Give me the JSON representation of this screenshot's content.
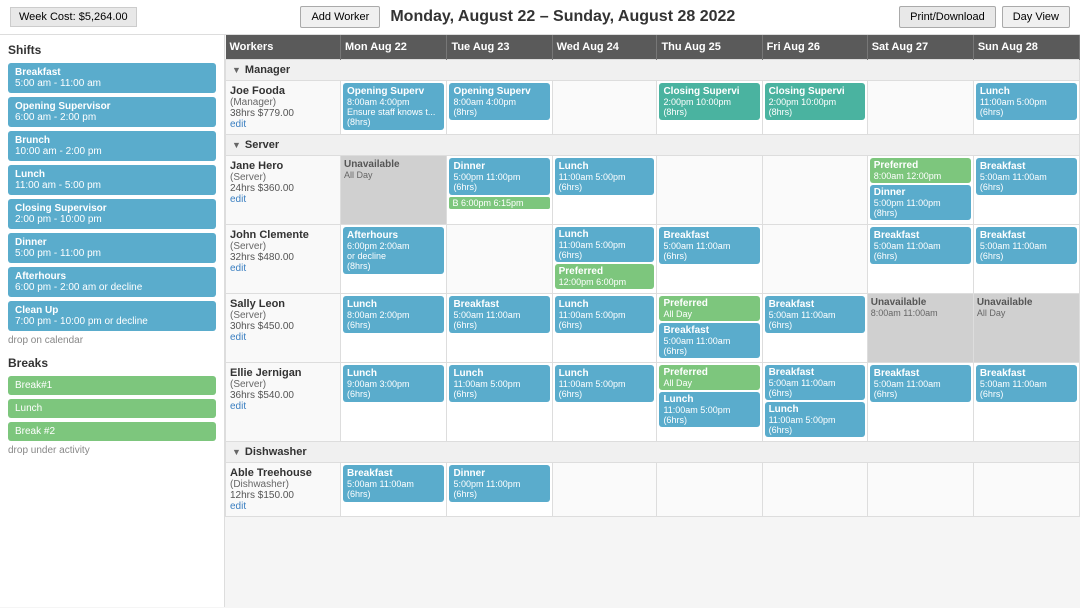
{
  "topBar": {
    "weekCost": "Week Cost: $5,264.00",
    "title": "Monday, August 22 – Sunday, August 28 2022",
    "printDownload": "Print/Download",
    "dayView": "Day View",
    "addWorker": "Add Worker"
  },
  "sidebar": {
    "shiftsTitle": "Shifts",
    "shifts": [
      {
        "name": "Breakfast",
        "time": "5:00 am - 11:00 am"
      },
      {
        "name": "Opening Supervisor",
        "time": "6:00 am - 2:00 pm"
      },
      {
        "name": "Brunch",
        "time": "10:00 am - 2:00 pm"
      },
      {
        "name": "Lunch",
        "time": "11:00 am - 5:00 pm"
      },
      {
        "name": "Closing Supervisor",
        "time": "2:00 pm - 10:00 pm"
      },
      {
        "name": "Dinner",
        "time": "5:00 pm - 11:00 pm"
      },
      {
        "name": "Afterhours",
        "time": "6:00 pm - 2:00 am or decline"
      },
      {
        "name": "Clean Up",
        "time": "7:00 pm - 10:00 pm or decline"
      }
    ],
    "dropOnCalendar": "drop on calendar",
    "breaksTitle": "Breaks",
    "breaks": [
      {
        "name": "Break#1"
      },
      {
        "name": "Lunch"
      },
      {
        "name": "Break #2"
      }
    ],
    "dropUnderActivity": "drop under activity"
  },
  "columns": {
    "workers": "Workers",
    "days": [
      "Mon Aug 22",
      "Tue Aug 23",
      "Wed Aug 24",
      "Thu Aug 25",
      "Fri Aug 26",
      "Sat Aug 27",
      "Sun Aug 28"
    ]
  },
  "sections": [
    {
      "name": "Manager",
      "workers": [
        {
          "name": "Joe Fooda",
          "role": "Manager",
          "hours": "38hrs $779.00",
          "days": [
            {
              "type": "shift",
              "class": "blue",
              "title": "Opening Superv",
              "time": "8:00am 4:00pm",
              "extra": "Ensure staff knows t...",
              "duration": "(8hrs)"
            },
            {
              "type": "shift",
              "class": "blue",
              "title": "Opening Superv",
              "time": "8:00am 4:00pm",
              "duration": "(8hrs)"
            },
            {
              "type": "empty"
            },
            {
              "type": "shift",
              "class": "teal",
              "title": "Closing Supervi",
              "time": "2:00pm 10:00pm",
              "duration": "(8hrs)"
            },
            {
              "type": "shift",
              "class": "teal",
              "title": "Closing Supervi",
              "time": "2:00pm 10:00pm",
              "duration": "(8hrs)"
            },
            {
              "type": "empty"
            },
            {
              "type": "shift",
              "class": "blue",
              "title": "Lunch",
              "time": "11:00am 5:00pm",
              "duration": "(6hrs)"
            }
          ]
        }
      ]
    },
    {
      "name": "Server",
      "workers": [
        {
          "name": "Jane Hero",
          "role": "Server",
          "hours": "24hrs $360.00",
          "days": [
            {
              "type": "unavail",
              "label": "Unavailable",
              "sub": "All Day"
            },
            {
              "type": "shift",
              "class": "blue",
              "title": "Dinner",
              "time": "5:00pm 11:00pm",
              "duration": "(6hrs)",
              "note": "B 6:00pm 6:15pm"
            },
            {
              "type": "shift",
              "class": "blue",
              "title": "Lunch",
              "time": "11:00am 5:00pm",
              "duration": "(6hrs)"
            },
            {
              "type": "empty"
            },
            {
              "type": "empty"
            },
            {
              "type": "multi",
              "shifts": [
                {
                  "class": "pref",
                  "title": "Preferred",
                  "time": "8:00am 12:00pm"
                },
                {
                  "class": "blue",
                  "title": "Dinner",
                  "time": "5:00pm 11:00pm",
                  "duration": "(8hrs)"
                }
              ]
            },
            {
              "type": "shift",
              "class": "blue",
              "title": "Breakfast",
              "time": "5:00am 11:00am",
              "duration": "(6hrs)"
            }
          ]
        },
        {
          "name": "John Clemente",
          "role": "Server",
          "hours": "32hrs $480.00",
          "days": [
            {
              "type": "shift",
              "class": "blue",
              "title": "Afterhours",
              "time": "6:00pm 2:00am",
              "extra": "or decline",
              "duration": "(8hrs)"
            },
            {
              "type": "empty"
            },
            {
              "type": "multi2",
              "shifts": [
                {
                  "class": "blue",
                  "title": "Lunch",
                  "time": "11:00am 5:00pm",
                  "duration": "(6hrs)"
                },
                {
                  "class": "pref",
                  "title": "Preferred",
                  "time": "12:00pm 6:00pm"
                }
              ]
            },
            {
              "type": "shift",
              "class": "blue",
              "title": "Breakfast",
              "time": "5:00am 11:00am",
              "duration": "(6hrs)"
            },
            {
              "type": "empty"
            },
            {
              "type": "shift",
              "class": "blue",
              "title": "Breakfast",
              "time": "5:00am 11:00am",
              "duration": "(6hrs)"
            },
            {
              "type": "shift",
              "class": "blue",
              "title": "Breakfast",
              "time": "5:00am 11:00am",
              "duration": "(6hrs)"
            }
          ]
        },
        {
          "name": "Sally Leon",
          "role": "Server",
          "hours": "30hrs $450.00",
          "days": [
            {
              "type": "shift",
              "class": "blue",
              "title": "Lunch",
              "time": "8:00am 2:00pm",
              "duration": "(6hrs)"
            },
            {
              "type": "shift",
              "class": "blue",
              "title": "Breakfast",
              "time": "5:00am 11:00am",
              "duration": "(6hrs)"
            },
            {
              "type": "shift",
              "class": "blue",
              "title": "Lunch",
              "time": "11:00am 5:00pm",
              "duration": "(6hrs)"
            },
            {
              "type": "multi2",
              "shifts": [
                {
                  "class": "pref",
                  "title": "Preferred",
                  "time": "All Day"
                },
                {
                  "class": "blue",
                  "title": "Breakfast",
                  "time": "5:00am 11:00am",
                  "duration": "(6hrs)"
                }
              ]
            },
            {
              "type": "shift",
              "class": "blue",
              "title": "Breakfast",
              "time": "5:00am 11:00am",
              "duration": "(6hrs)"
            },
            {
              "type": "unavail",
              "label": "Unavailable",
              "sub": "8:00am 11:00am"
            },
            {
              "type": "unavail",
              "label": "Unavailable",
              "sub": "All Day"
            }
          ]
        },
        {
          "name": "Ellie Jernigan",
          "role": "Server",
          "hours": "36hrs $540.00",
          "days": [
            {
              "type": "shift",
              "class": "blue",
              "title": "Lunch",
              "time": "9:00am 3:00pm",
              "duration": "(6hrs)"
            },
            {
              "type": "shift",
              "class": "blue",
              "title": "Lunch",
              "time": "11:00am 5:00pm",
              "duration": "(6hrs)"
            },
            {
              "type": "shift",
              "class": "blue",
              "title": "Lunch",
              "time": "11:00am 5:00pm",
              "duration": "(6hrs)"
            },
            {
              "type": "multi2",
              "shifts": [
                {
                  "class": "pref",
                  "title": "Preferred",
                  "time": "All Day"
                },
                {
                  "class": "blue",
                  "title": "Lunch",
                  "time": "11:00am 5:00pm",
                  "duration": "(6hrs)"
                }
              ]
            },
            {
              "type": "multi2",
              "shifts": [
                {
                  "class": "blue",
                  "title": "Breakfast",
                  "time": "5:00am 11:00am",
                  "duration": "(6hrs)"
                },
                {
                  "class": "blue",
                  "title": "Lunch",
                  "time": "11:00am 5:00pm",
                  "duration": "(6hrs)"
                }
              ]
            },
            {
              "type": "shift",
              "class": "blue",
              "title": "Breakfast",
              "time": "5:00am 11:00am",
              "duration": "(6hrs)"
            },
            {
              "type": "shift",
              "class": "blue",
              "title": "Breakfast",
              "time": "5:00am 11:00am",
              "duration": "(6hrs)"
            }
          ]
        }
      ]
    },
    {
      "name": "Dishwasher",
      "workers": [
        {
          "name": "Able Treehouse",
          "role": "Dishwasher",
          "hours": "12hrs $150.00",
          "days": [
            {
              "type": "shift",
              "class": "blue",
              "title": "Breakfast",
              "time": "5:00am 11:00am",
              "duration": "(6hrs)"
            },
            {
              "type": "shift",
              "class": "blue",
              "title": "Dinner",
              "time": "5:00pm 11:00pm",
              "duration": "(6hrs)"
            },
            {
              "type": "empty"
            },
            {
              "type": "empty"
            },
            {
              "type": "empty"
            },
            {
              "type": "empty"
            },
            {
              "type": "empty"
            }
          ]
        }
      ]
    }
  ]
}
